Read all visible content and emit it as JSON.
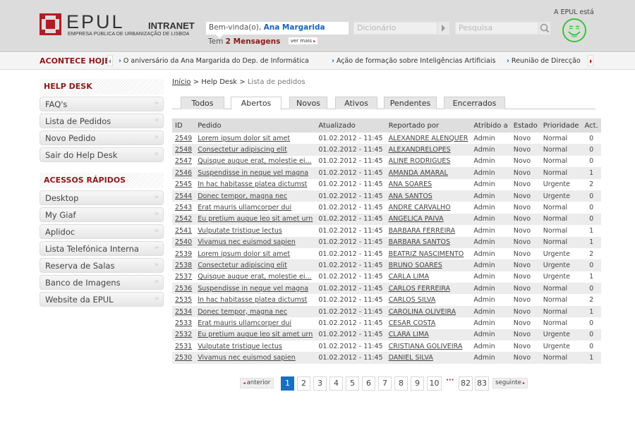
{
  "header": {
    "logo_text": "EPUL",
    "logo_intranet": "INTRANET",
    "logo_subtitle": "EMPRESA PÚBLICA DE URBANIZAÇÃO DE LISBOA",
    "welcome_prefix": "Bem-vinda(o),",
    "user_name": "Ana Margarida",
    "messages_prefix": "Tem",
    "messages_count": "2 Mensagens",
    "ver_mais": "ver mais",
    "dictionary_placeholder": "Dicionário",
    "search_placeholder": "Pesquisa",
    "mood_label": "A EPUL está",
    "mood_icon": "smiley-icon",
    "brand_color": "#b01e23",
    "mood_color": "#3cc23c"
  },
  "ticker": {
    "title": "ACONTECE HOJE",
    "items": [
      "O aniversário da Ana Margarida do Dep. de Informática",
      "Ação de formação sobre Inteligências Artificiais",
      "Reunião de Direcção"
    ]
  },
  "sidebar": {
    "help_desk": {
      "title": "HELP DESK",
      "items": [
        "FAQ's",
        "Lista de Pedidos",
        "Novo Pedido",
        "Sair do Help Desk"
      ]
    },
    "quick_access": {
      "title": "ACESSOS RÁPIDOS",
      "items": [
        "Desktop",
        "My Giaf",
        "Aplidoc",
        "Lista Telefónica Interna",
        "Reserva de Salas",
        "Banco de Imagens",
        "Website da EPUL"
      ]
    }
  },
  "breadcrumb": {
    "home": "Início",
    "sep": ">",
    "section": "Help Desk",
    "current": "Lista de pedidos"
  },
  "tabs": [
    {
      "label": "Todos",
      "active": false
    },
    {
      "label": "Abertos",
      "active": true
    },
    {
      "label": "Novos",
      "active": false
    },
    {
      "label": "Ativos",
      "active": false
    },
    {
      "label": "Pendentes",
      "active": false
    },
    {
      "label": "Encerrados",
      "active": false
    }
  ],
  "table": {
    "headers": [
      "ID",
      "Pedido",
      "Atualizado",
      "Reportado por",
      "Atribido a",
      "Estado",
      "Prioridade",
      "Act."
    ],
    "rows": [
      {
        "id": "2549",
        "pedido": "Lorem ipsum dolor sit amet",
        "atualizado": "01.02.2012 - 11:45",
        "reportado": "ALEXANDRE ALENQUER",
        "atribuido": "Admin",
        "estado": "Novo",
        "prioridade": "Normal",
        "act": "0"
      },
      {
        "id": "2548",
        "pedido": "Consectetur adipiscing elit",
        "atualizado": "01.02.2012 - 11:45",
        "reportado": "ALEXANDRELOPES",
        "atribuido": "Admin",
        "estado": "Novo",
        "prioridade": "Normal",
        "act": "0"
      },
      {
        "id": "2547",
        "pedido": "Quisque augue erat, molestie ei...",
        "atualizado": "01.02.2012 - 11:45",
        "reportado": "ALINE RODRIGUES",
        "atribuido": "Admin",
        "estado": "Novo",
        "prioridade": "Normal",
        "act": "0"
      },
      {
        "id": "2546",
        "pedido": "Suspendisse in neque vel magna",
        "atualizado": "01.02.2012 - 11:45",
        "reportado": "AMANDA AMARAL",
        "atribuido": "Admin",
        "estado": "Novo",
        "prioridade": "Normal",
        "act": "1"
      },
      {
        "id": "2545",
        "pedido": "In hac habitasse platea dictumst",
        "atualizado": "01.02.2012 - 11:45",
        "reportado": "ANA SOARES",
        "atribuido": "Admin",
        "estado": "Novo",
        "prioridade": "Urgente",
        "act": "2"
      },
      {
        "id": "2544",
        "pedido": "Donec tempor, magna nec",
        "atualizado": "01.02.2012 - 11:45",
        "reportado": "ANA SANTOS",
        "atribuido": "Admin",
        "estado": "Novo",
        "prioridade": "Urgente",
        "act": "0"
      },
      {
        "id": "2543",
        "pedido": "Erat mauris ullamcorper dui",
        "atualizado": "01.02.2012 - 11:45",
        "reportado": "ANDRE CARVALHO",
        "atribuido": "Admin",
        "estado": "Novo",
        "prioridade": "Normal",
        "act": "0"
      },
      {
        "id": "2542",
        "pedido": "Eu pretium augue leo sit amet urn",
        "atualizado": "01.02.2012 - 11:45",
        "reportado": "ANGELICA PAIVA",
        "atribuido": "Admin",
        "estado": "Novo",
        "prioridade": "Normal",
        "act": "0"
      },
      {
        "id": "2541",
        "pedido": "Vulputate tristique lectus",
        "atualizado": "01.02.2012 - 11:45",
        "reportado": "BARBARA FERREIRA",
        "atribuido": "Admin",
        "estado": "Novo",
        "prioridade": "Normal",
        "act": "1"
      },
      {
        "id": "2540",
        "pedido": "Vivamus nec euismod sapien",
        "atualizado": "01.02.2012 - 11:45",
        "reportado": "BARBARA SANTOS",
        "atribuido": "Admin",
        "estado": "Novo",
        "prioridade": "Normal",
        "act": "1"
      },
      {
        "id": "2539",
        "pedido": "Lorem ipsum dolor sit amet",
        "atualizado": "01.02.2012 - 11:45",
        "reportado": "BEATRIZ NASCIMENTO",
        "atribuido": "Admin",
        "estado": "Novo",
        "prioridade": "Urgente",
        "act": "2"
      },
      {
        "id": "2538",
        "pedido": "Consectetur adipiscing elit",
        "atualizado": "01.02.2012 - 11:45",
        "reportado": "BRUNO SOARES",
        "atribuido": "Admin",
        "estado": "Novo",
        "prioridade": "Urgente",
        "act": "0"
      },
      {
        "id": "2537",
        "pedido": "Quisque augue erat, molestie ei...",
        "atualizado": "01.02.2012 - 11:45",
        "reportado": "CARLA LIMA",
        "atribuido": "Admin",
        "estado": "Novo",
        "prioridade": "Urgente",
        "act": "1"
      },
      {
        "id": "2536",
        "pedido": "Suspendisse in neque vel magna",
        "atualizado": "01.02.2012 - 11:45",
        "reportado": "CARLOS FERREIRA",
        "atribuido": "Admin",
        "estado": "Novo",
        "prioridade": "Normal",
        "act": "0"
      },
      {
        "id": "2535",
        "pedido": "In hac habitasse platea dictumst",
        "atualizado": "01.02.2012 - 11:45",
        "reportado": "CARLOS SILVA",
        "atribuido": "Admin",
        "estado": "Novo",
        "prioridade": "Normal",
        "act": "2"
      },
      {
        "id": "2534",
        "pedido": "Donec tempor, magna nec",
        "atualizado": "01.02.2012 - 11:45",
        "reportado": "CAROLINA OLIVEIRA",
        "atribuido": "Admin",
        "estado": "Novo",
        "prioridade": "Normal",
        "act": "1"
      },
      {
        "id": "2533",
        "pedido": "Erat mauris ullamcorper dui",
        "atualizado": "01.02.2012 - 11:45",
        "reportado": "CESAR COSTA",
        "atribuido": "Admin",
        "estado": "Novo",
        "prioridade": "Normal",
        "act": "0"
      },
      {
        "id": "2532",
        "pedido": "Eu pretium augue leo sit amet urn",
        "atualizado": "01.02.2012 - 11:45",
        "reportado": "CLARA LIMA",
        "atribuido": "Admin",
        "estado": "Novo",
        "prioridade": "Urgente",
        "act": "0"
      },
      {
        "id": "2531",
        "pedido": "Vulputate tristique lectus",
        "atualizado": "01.02.2012 - 11:45",
        "reportado": "CRISTIANA GOLIVEIRA",
        "atribuido": "Admin",
        "estado": "Novo",
        "prioridade": "Urgente",
        "act": "0"
      },
      {
        "id": "2530",
        "pedido": "Vivamus nec euismod sapien",
        "atualizado": "01.02.2012 - 11:45",
        "reportado": "DANIEL SILVA",
        "atribuido": "Admin",
        "estado": "Novo",
        "prioridade": "Normal",
        "act": "1"
      }
    ]
  },
  "pagination": {
    "prev": "anterior",
    "next": "seguinte",
    "pages": [
      "1",
      "2",
      "3",
      "4",
      "5",
      "6",
      "7",
      "8",
      "9",
      "10"
    ],
    "ellipsis": "···",
    "last_pages": [
      "82",
      "83"
    ],
    "current": "1",
    "active_color": "#1a6fc2"
  }
}
